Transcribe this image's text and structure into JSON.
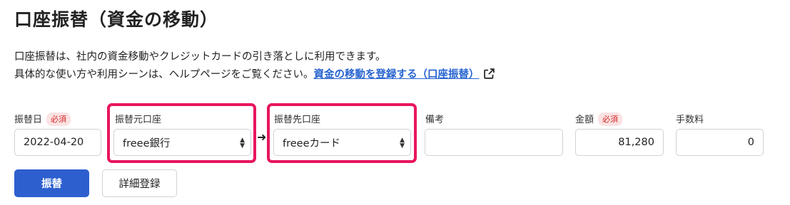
{
  "page": {
    "title": "口座振替（資金の移動）",
    "description_line1": "口座振替は、社内の資金移動やクレジットカードの引き落としに利用できます。",
    "description_line2": "具体的な使い方や利用シーンは、ヘルプページをご覧ください。",
    "help_link_text": "資金の移動を登録する（口座振替）",
    "external_link_icon": "external-link-icon"
  },
  "form": {
    "date": {
      "label": "振替日",
      "required_badge": "必須",
      "value": "2022-04-20"
    },
    "from_account": {
      "label": "振替元口座",
      "value": "freee銀行"
    },
    "arrow": "➜",
    "to_account": {
      "label": "振替先口座",
      "value": "freeeカード"
    },
    "memo": {
      "label": "備考",
      "value": ""
    },
    "amount": {
      "label": "金額",
      "required_badge": "必須",
      "value": "81,280"
    },
    "fee": {
      "label": "手数料",
      "value": "0"
    }
  },
  "buttons": {
    "transfer": "振替",
    "detail_register": "詳細登録"
  },
  "colors": {
    "primary": "#2d5fcf",
    "highlight": "#e8155f",
    "link": "#2864d0",
    "required": "#d52a2a"
  }
}
